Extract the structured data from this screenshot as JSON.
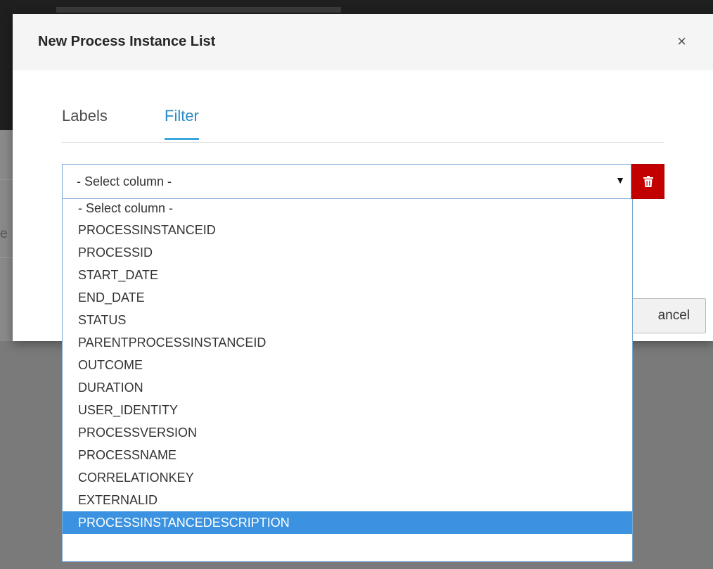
{
  "modal": {
    "title": "New Process Instance List",
    "close_symbol": "×"
  },
  "tabs": [
    {
      "label": "Labels",
      "active": false
    },
    {
      "label": "Filter",
      "active": true
    }
  ],
  "filter": {
    "selected_value": "- Select column -",
    "delete_icon": "trash-icon",
    "options": [
      "- Select column -",
      "PROCESSINSTANCEID",
      "PROCESSID",
      "START_DATE",
      "END_DATE",
      "STATUS",
      "PARENTPROCESSINSTANCEID",
      "OUTCOME",
      "DURATION",
      "USER_IDENTITY",
      "PROCESSVERSION",
      "PROCESSNAME",
      "CORRELATIONKEY",
      "EXTERNALID",
      "PROCESSINSTANCEDESCRIPTION"
    ],
    "highlighted_option": "PROCESSINSTANCEDESCRIPTION"
  },
  "footer": {
    "cancel_label": "ancel"
  },
  "background": {
    "fragment": "e"
  },
  "colors": {
    "accent": "#39a5dc",
    "danger": "#c30000",
    "highlight": "#3a92e0"
  }
}
